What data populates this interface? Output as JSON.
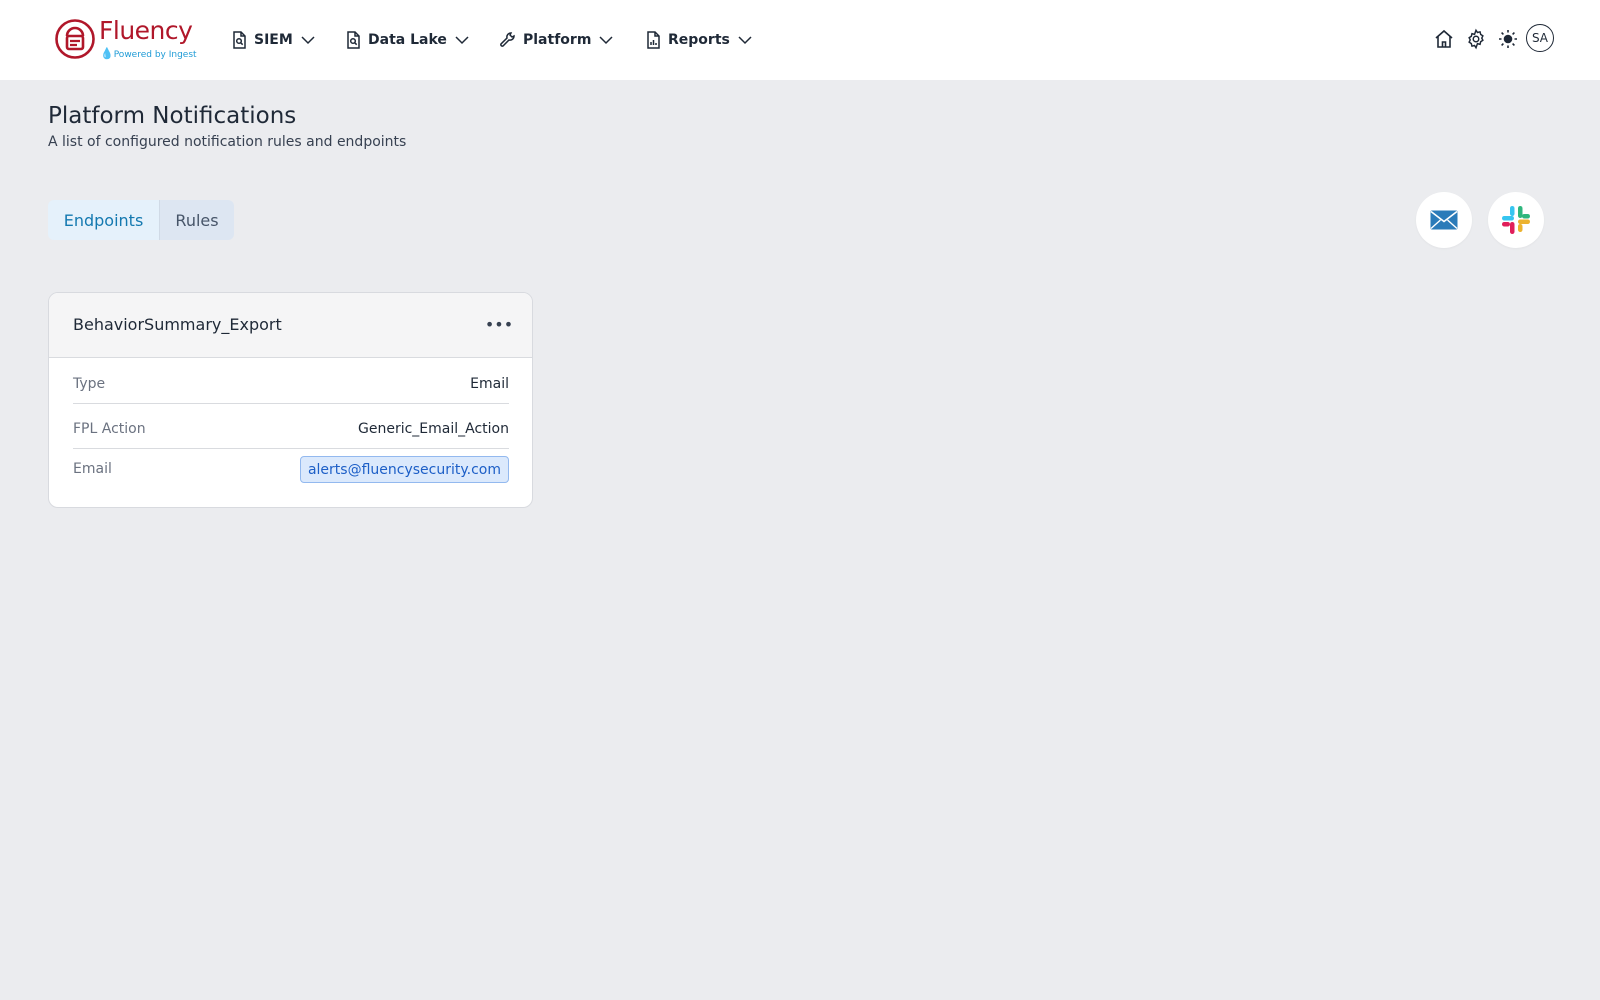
{
  "brand": {
    "name": "Fluency",
    "tagline": "Powered by Ingest",
    "color": "#b0172a",
    "tagline_color": "#1f9bd6"
  },
  "nav": [
    {
      "label": "SIEM",
      "icon": "file-search-icon"
    },
    {
      "label": "Data Lake",
      "icon": "file-search-icon"
    },
    {
      "label": "Platform",
      "icon": "wrench-icon"
    },
    {
      "label": "Reports",
      "icon": "chart-file-icon"
    }
  ],
  "utility": {
    "icons": [
      "home-icon",
      "gear-icon",
      "sun-icon"
    ],
    "avatar_initials": "SA"
  },
  "page": {
    "title": "Platform Notifications",
    "subtitle": "A list of configured notification rules and endpoints"
  },
  "tabs": [
    {
      "label": "Endpoints",
      "active": true
    },
    {
      "label": "Rules",
      "active": false
    }
  ],
  "actions": [
    "email-endpoint-icon",
    "slack-endpoint-icon"
  ],
  "endpoint_card": {
    "name": "BehaviorSummary_Export",
    "menu_glyph": "•••",
    "fields": [
      {
        "key": "Type",
        "value": "Email"
      },
      {
        "key": "FPL Action",
        "value": "Generic_Email_Action"
      },
      {
        "key": "Email",
        "value": "alerts@fluencysecurity.com"
      }
    ]
  },
  "colors": {
    "background": "#ebecef",
    "accent": "#1479b0",
    "pill_bg": "#dbe9fc",
    "pill_text": "#1d5fc7"
  }
}
